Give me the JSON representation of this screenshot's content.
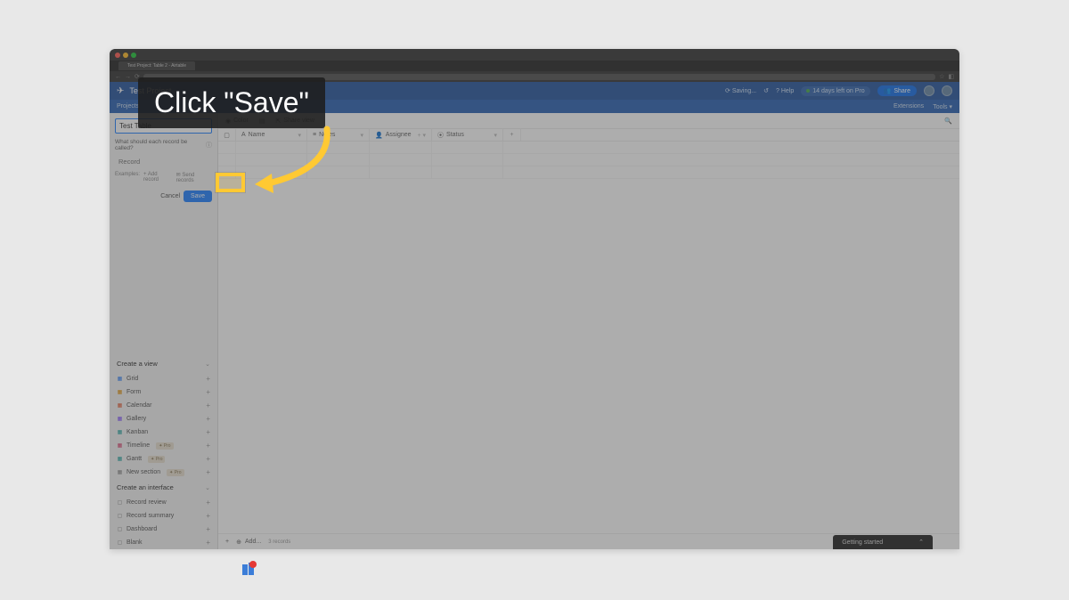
{
  "browser": {
    "tab_title": "Test Project: Table 2 - Airtable"
  },
  "header": {
    "base_name": "Test Project",
    "saving": "Saving...",
    "help": "Help",
    "trial": "14 days left on Pro",
    "share": "Share"
  },
  "tabsrow": {
    "projects": "Projects",
    "extensions": "Extensions",
    "tools": "Tools"
  },
  "rename": {
    "value": "Test Table",
    "prompt": "What should each record be called?",
    "record_placeholder": "Record",
    "examples_label": "Examples:",
    "example1": "Add record",
    "example2": "Send records",
    "cancel": "Cancel",
    "save": "Save"
  },
  "sidebar": {
    "create_view": "Create a view",
    "views": [
      {
        "label": "Grid",
        "color": "#2d7ff9"
      },
      {
        "label": "Form",
        "color": "#e08d00"
      },
      {
        "label": "Calendar",
        "color": "#e4572e"
      },
      {
        "label": "Gallery",
        "color": "#7c4dff"
      },
      {
        "label": "Kanban",
        "color": "#20a39e"
      },
      {
        "label": "Timeline",
        "color": "#d83a68",
        "pro": true
      },
      {
        "label": "Gantt",
        "color": "#20a39e",
        "pro": true
      },
      {
        "label": "New section",
        "pro": true
      }
    ],
    "pro_badge": "Pro",
    "create_interface": "Create an interface",
    "interfaces": [
      {
        "label": "Record review"
      },
      {
        "label": "Record summary"
      },
      {
        "label": "Dashboard"
      },
      {
        "label": "Blank"
      }
    ]
  },
  "toolbar": {
    "color": "Color",
    "share_view": "Share view"
  },
  "columns": {
    "name": "Name",
    "notes": "Notes",
    "assignee": "Assignee",
    "status": "Status"
  },
  "footer": {
    "add": "Add...",
    "count": "3 records"
  },
  "getting_started": "Getting started",
  "instruction": "Click \"Save\""
}
